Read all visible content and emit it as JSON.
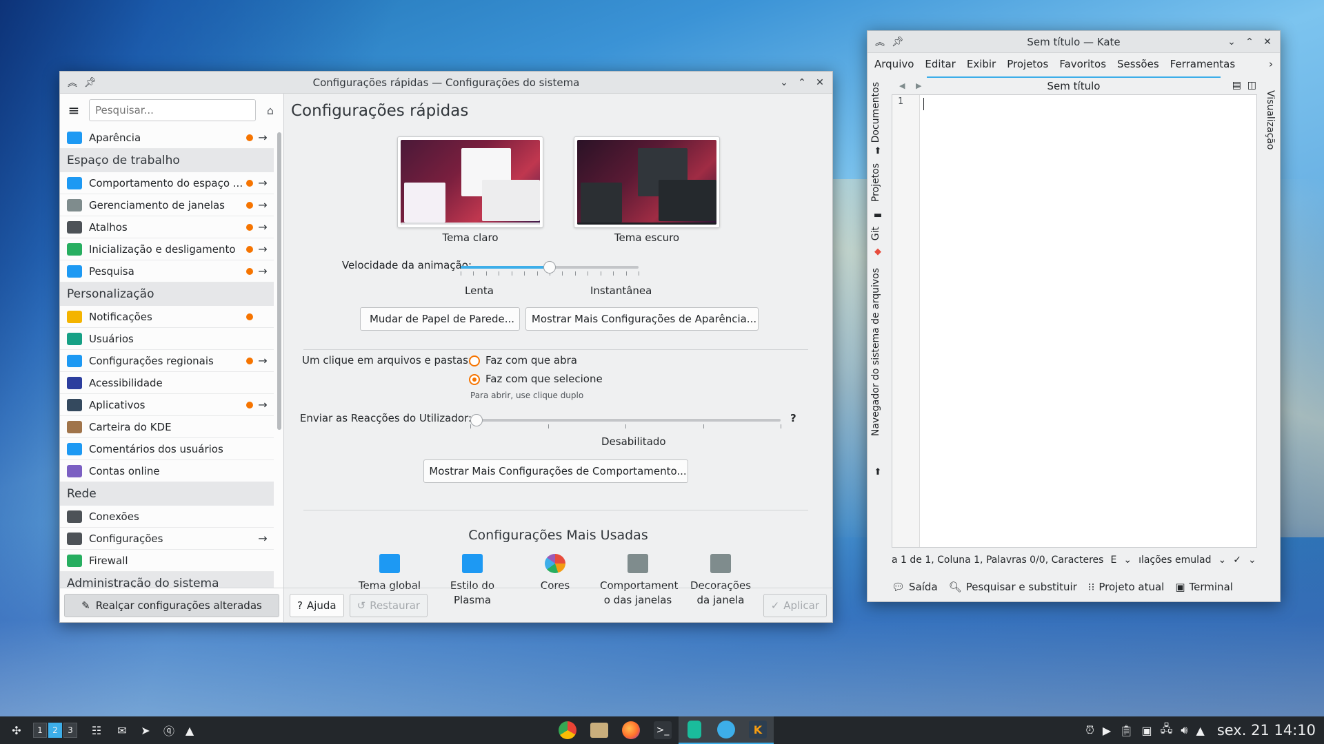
{
  "settings_window": {
    "title": "Configurações rápidas — Configurações do sistema",
    "search_placeholder": "Pesquisar...",
    "page_title": "Configurações rápidas",
    "sidebar": [
      {
        "type": "item",
        "label": "Aparência",
        "dot": true,
        "arrow": true,
        "icon": "appearance-icon",
        "color": "#1d99f3"
      },
      {
        "type": "header",
        "label": "Espaço de trabalho"
      },
      {
        "type": "item",
        "label": "Comportamento do espaço ...",
        "dot": true,
        "arrow": true,
        "icon": "workspace-icon",
        "color": "#1d99f3"
      },
      {
        "type": "item",
        "label": "Gerenciamento de janelas",
        "dot": true,
        "arrow": true,
        "icon": "window-mgmt-icon",
        "color": "#7f8c8d"
      },
      {
        "type": "item",
        "label": "Atalhos",
        "dot": true,
        "arrow": true,
        "icon": "keyboard-icon",
        "color": "#4d5257"
      },
      {
        "type": "item",
        "label": "Inicialização e desligamento",
        "dot": true,
        "arrow": true,
        "icon": "startup-icon",
        "color": "#27ae60"
      },
      {
        "type": "item",
        "label": "Pesquisa",
        "dot": true,
        "arrow": true,
        "icon": "search-icon",
        "color": "#1d99f3"
      },
      {
        "type": "header",
        "label": "Personalização"
      },
      {
        "type": "item",
        "label": "Notificações",
        "dot": true,
        "arrow": false,
        "icon": "bell-icon",
        "color": "#f4b400"
      },
      {
        "type": "item",
        "label": "Usuários",
        "dot": false,
        "arrow": false,
        "icon": "user-icon",
        "color": "#16a085"
      },
      {
        "type": "item",
        "label": "Configurações regionais",
        "dot": true,
        "arrow": true,
        "icon": "regional-icon",
        "color": "#1d99f3"
      },
      {
        "type": "item",
        "label": "Acessibilidade",
        "dot": false,
        "arrow": false,
        "icon": "accessibility-icon",
        "color": "#2c3e9e"
      },
      {
        "type": "item",
        "label": "Aplicativos",
        "dot": true,
        "arrow": true,
        "icon": "applications-icon",
        "color": "#34495e"
      },
      {
        "type": "item",
        "label": "Carteira do KDE",
        "dot": false,
        "arrow": false,
        "icon": "wallet-icon",
        "color": "#a0744a"
      },
      {
        "type": "item",
        "label": "Comentários dos usuários",
        "dot": false,
        "arrow": false,
        "icon": "feedback-icon",
        "color": "#1d99f3"
      },
      {
        "type": "item",
        "label": "Contas online",
        "dot": false,
        "arrow": false,
        "icon": "online-accounts-icon",
        "color": "#7b5fc2"
      },
      {
        "type": "header",
        "label": "Rede"
      },
      {
        "type": "item",
        "label": "Conexões",
        "dot": false,
        "arrow": false,
        "icon": "connections-icon",
        "color": "#4d5257"
      },
      {
        "type": "item",
        "label": "Configurações",
        "dot": false,
        "arrow": true,
        "icon": "network-settings-icon",
        "color": "#4d5257"
      },
      {
        "type": "item",
        "label": "Firewall",
        "dot": false,
        "arrow": false,
        "icon": "firewall-icon",
        "color": "#27ae60"
      },
      {
        "type": "header",
        "label": "Administração do sistema"
      }
    ],
    "highlight_button": "Realçar configurações alteradas",
    "themes": {
      "light_label": "Tema claro",
      "dark_label": "Tema escuro"
    },
    "animation": {
      "label": "Velocidade da animação:",
      "slow": "Lenta",
      "instant": "Instantânea",
      "value_fraction": 0.5
    },
    "wallpaper_button": "Mudar de Papel de Parede...",
    "more_appearance_button": "Mostrar Mais Configurações de Aparência...",
    "click": {
      "label": "Um clique em arquivos e pastas:",
      "option_open": "Faz com que abra",
      "option_select": "Faz com que selecione",
      "selected": "select",
      "hint": "Para abrir, use clique duplo"
    },
    "feedback": {
      "label": "Enviar as Reacções do Utilizador:",
      "value_label": "Desabilitado",
      "help": "?",
      "value_fraction": 0.0
    },
    "more_behavior_button": "Mostrar Mais Configurações de Comportamento...",
    "most_used_title": "Configurações Mais Usadas",
    "most_used": [
      {
        "label": "Tema global",
        "icon": "global-theme-icon"
      },
      {
        "label": "Estilo do Plasma",
        "icon": "plasma-style-icon"
      },
      {
        "label": "Cores",
        "icon": "colors-icon"
      },
      {
        "label": "Comportament o das janelas",
        "icon": "window-behavior-icon"
      },
      {
        "label": "Decorações da janela",
        "icon": "window-decorations-icon"
      }
    ],
    "footer": {
      "help": "Ajuda",
      "reset": "Restaurar",
      "apply": "Aplicar"
    }
  },
  "kate_window": {
    "title": "Sem título — Kate",
    "menu": [
      "Arquivo",
      "Editar",
      "Exibir",
      "Projetos",
      "Favoritos",
      "Sessões",
      "Ferramentas"
    ],
    "left_tabs": [
      "Documentos",
      "Projetos",
      "Git",
      "Navegador do sistema de arquivos"
    ],
    "right_tab": "Visualização",
    "doc_tab": "Sem título",
    "line_number": "1",
    "status": {
      "position": "a 1 de 1, Coluna 1, Palavras 0/0, Caracteres",
      "mode_short": "E",
      "input_mode": "ılações emulad"
    },
    "footer": [
      "Saída",
      "Pesquisar e substituir",
      "Projeto atual",
      "Terminal"
    ]
  },
  "taskbar": {
    "pager": [
      "1",
      "2",
      "3"
    ],
    "active_desktop": "2",
    "clock": "sex. 21  14:10"
  }
}
